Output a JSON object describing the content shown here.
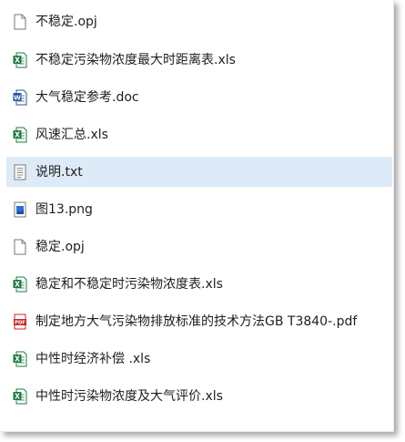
{
  "files": [
    {
      "name": "不稳定.opj",
      "icon": "blank-file-icon"
    },
    {
      "name": "不稳定污染物浓度最大时距离表.xls",
      "icon": "excel-file-icon"
    },
    {
      "name": "大气稳定参考.doc",
      "icon": "word-file-icon"
    },
    {
      "name": "风速汇总.xls",
      "icon": "excel-file-icon"
    },
    {
      "name": "说明.txt",
      "icon": "text-file-icon",
      "selected": true
    },
    {
      "name": "图13.png",
      "icon": "image-file-icon"
    },
    {
      "name": "稳定.opj",
      "icon": "blank-file-icon"
    },
    {
      "name": "稳定和不稳定时污染物浓度表.xls",
      "icon": "excel-file-icon"
    },
    {
      "name": "制定地方大气污染物排放标准的技术方法GB T3840-.pdf",
      "icon": "pdf-file-icon"
    },
    {
      "name": "中性时经济补偿 .xls",
      "icon": "excel-file-icon"
    },
    {
      "name": "中性时污染物浓度及大气评价.xls",
      "icon": "excel-file-icon"
    }
  ],
  "icon_badges": {
    "excel": "X",
    "word": "W",
    "pdf": "PDF"
  },
  "colors": {
    "selection": "#ddeaf7",
    "excel": "#1f7a43",
    "word": "#2b5797",
    "pdf": "#c62828"
  }
}
